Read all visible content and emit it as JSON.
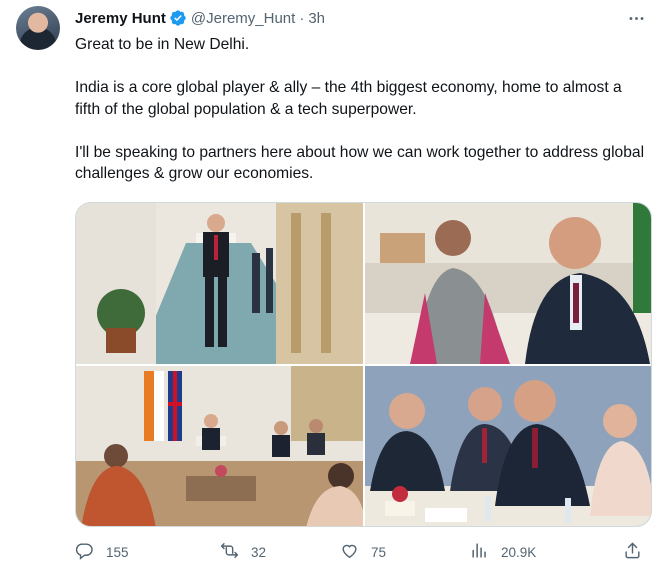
{
  "author": {
    "display_name": "Jeremy Hunt",
    "handle": "@Jeremy_Hunt",
    "separator": "·",
    "time": "3h",
    "verified_color": "#1d9bf0"
  },
  "icons": {
    "more": "more-options-icon",
    "reply": "reply-icon",
    "retweet": "retweet-icon",
    "like": "heart-icon",
    "views": "views-chart-icon",
    "share": "share-icon"
  },
  "tweet": {
    "paragraphs": [
      "Great to be in New Delhi.",
      "India is a core global player & ally – the 4th biggest economy, home to almost a fifth of the global population & a tech superpower.",
      "I'll be speaking to partners here about how we can work together to address global challenges & grow our economies."
    ]
  },
  "media": {
    "photo_count": 4
  },
  "actions": {
    "replies": "155",
    "retweets": "32",
    "likes": "75",
    "views": "20.9K"
  },
  "colors": {
    "text": "#0f1419",
    "secondary": "#536471",
    "border": "#cfd9de",
    "accent": "#1d9bf0"
  }
}
